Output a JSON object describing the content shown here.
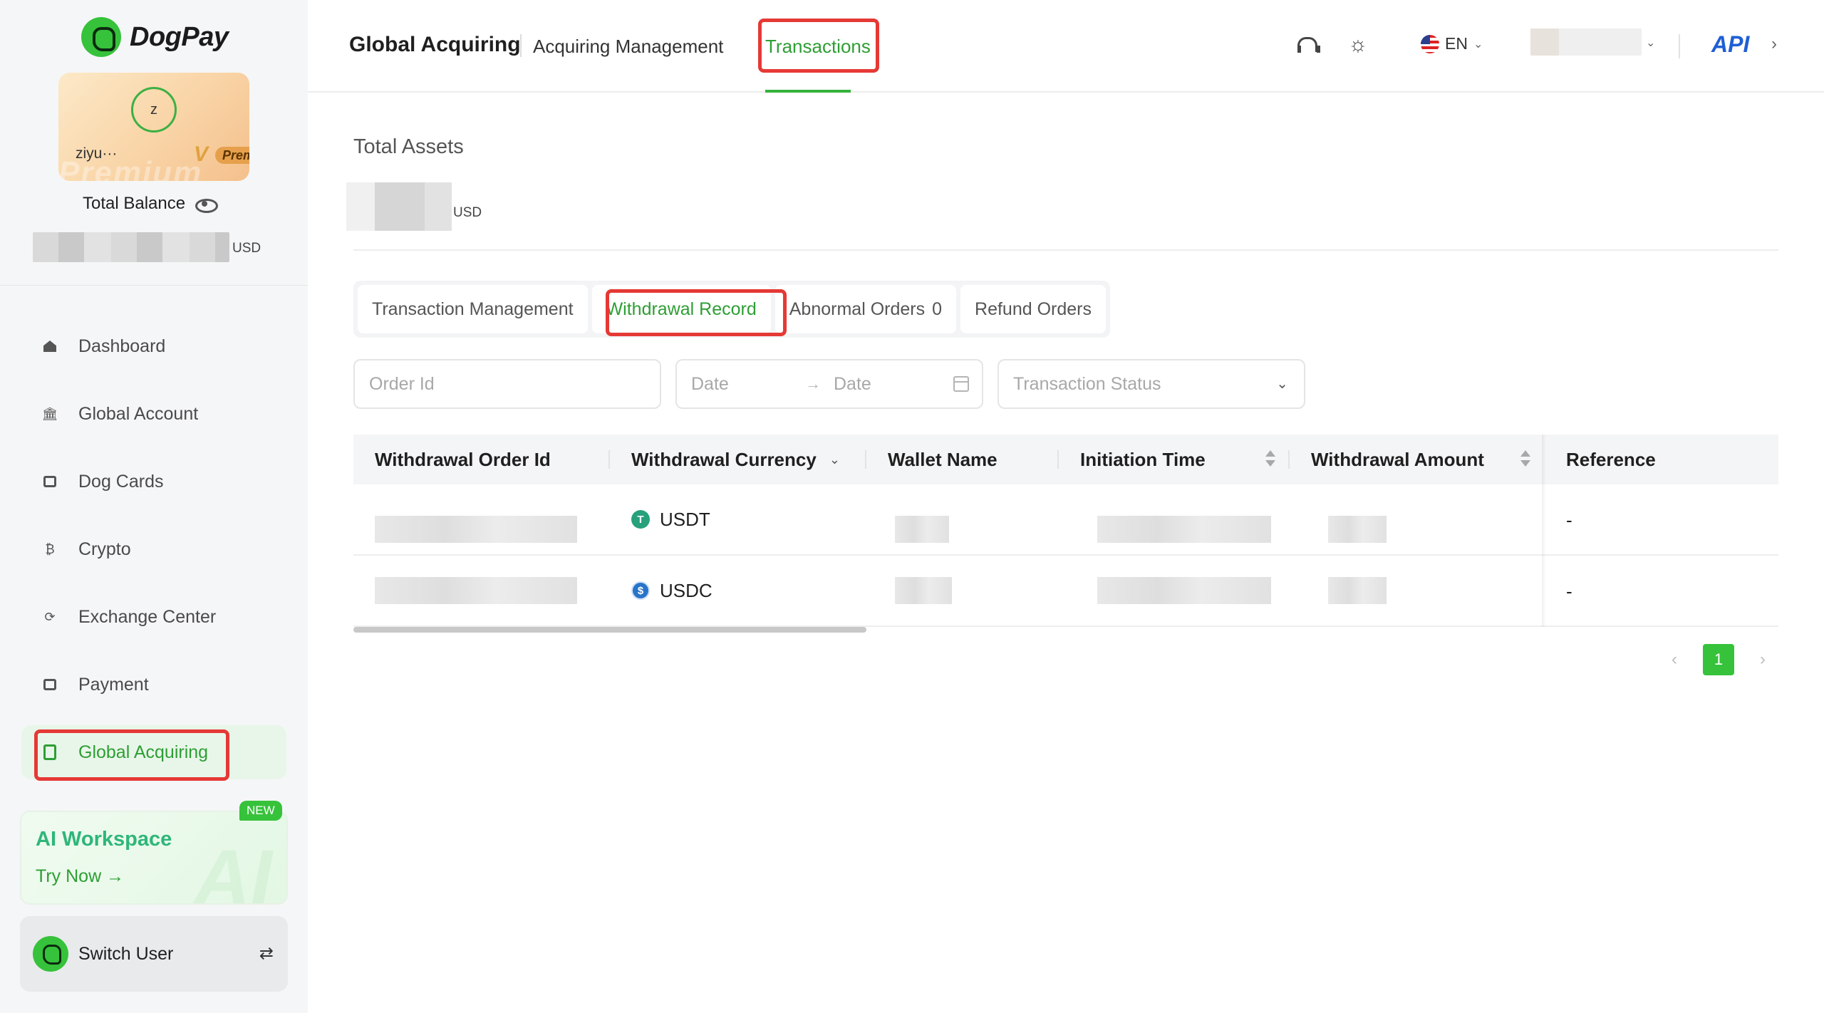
{
  "sidebar": {
    "brand": "DogPay",
    "profile": {
      "avatar_letter": "z",
      "username": "ziyu···",
      "badge": "Premium",
      "badge_watermark": "Premium"
    },
    "balance_label": "Total Balance",
    "balance_currency": "USD",
    "nav": [
      {
        "label": "Dashboard",
        "icon": "home-icon"
      },
      {
        "label": "Global Account",
        "icon": "bank-icon"
      },
      {
        "label": "Dog Cards",
        "icon": "card-icon"
      },
      {
        "label": "Crypto",
        "icon": "bitcoin-icon"
      },
      {
        "label": "Exchange Center",
        "icon": "exchange-icon"
      },
      {
        "label": "Payment",
        "icon": "wallet-icon"
      },
      {
        "label": "Global Acquiring",
        "icon": "document-icon",
        "active": true
      }
    ],
    "ai_workspace": {
      "title": "AI Workspace",
      "cta": "Try Now",
      "badge": "NEW"
    },
    "switch_user": "Switch User"
  },
  "header": {
    "title": "Global Acquiring",
    "subtitle": "Acquiring Management",
    "active_tab": "Transactions",
    "language": "EN",
    "api_label": "API"
  },
  "main": {
    "total_assets_label": "Total Assets",
    "total_assets_currency": "USD",
    "tabs": [
      {
        "label": "Transaction Management"
      },
      {
        "label": "Withdrawal Record",
        "active": true
      },
      {
        "label": "Abnormal Orders",
        "count": "0"
      },
      {
        "label": "Refund Orders"
      }
    ],
    "filters": {
      "order_id_placeholder": "Order Id",
      "date_start_placeholder": "Date",
      "date_end_placeholder": "Date",
      "status_placeholder": "Transaction Status"
    },
    "table": {
      "columns": [
        "Withdrawal Order Id",
        "Withdrawal Currency",
        "Wallet Name",
        "Initiation Time",
        "Withdrawal Amount",
        "Reference"
      ],
      "rows": [
        {
          "currency": "USDT",
          "reference": "-"
        },
        {
          "currency": "USDC",
          "reference": "-"
        }
      ]
    },
    "pagination": {
      "current_page": "1"
    }
  },
  "colors": {
    "accent": "#36c23a",
    "accent_text": "#2e9e34",
    "highlight": "#e53935",
    "api_blue": "#1f5fd4"
  }
}
